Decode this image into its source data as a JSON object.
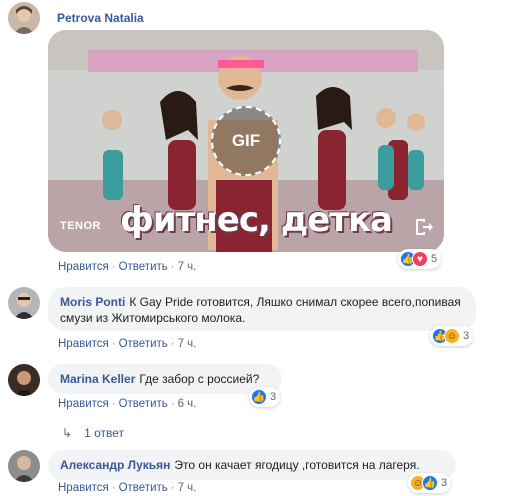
{
  "post": {
    "author": "Petrova Natalia",
    "gif": {
      "badge": "GIF",
      "provider": "TENOR",
      "caption": "фитнес, детка"
    },
    "actions": {
      "like": "Нравится",
      "reply": "Ответить",
      "time": "7 ч."
    },
    "reactions": {
      "count": "5",
      "types": [
        "like-icon",
        "love-icon"
      ]
    }
  },
  "comments": [
    {
      "author": "Moris Ponti",
      "text": "К Gay Pride готовится, Ляшко снимал скорее всего,попивая смузи из Житомирського молока.",
      "actions": {
        "like": "Нравится",
        "reply": "Ответить",
        "time": "7 ч."
      },
      "reactions": {
        "count": "3",
        "types": [
          "like-icon",
          "haha-icon"
        ]
      }
    },
    {
      "author": "Marina Keller",
      "text": "Где забор с россией?",
      "actions": {
        "like": "Нравится",
        "reply": "Ответить",
        "time": "6 ч."
      },
      "reactions": {
        "count": "3",
        "types": [
          "like-icon"
        ]
      },
      "replies": "1 ответ"
    },
    {
      "author": "Александр Лукьян",
      "text": "Это он качает ягодицу ,готовится на лагеря.",
      "actions": {
        "like": "Нравится",
        "reply": "Ответить",
        "time": "7 ч."
      },
      "reactions": {
        "count": "3",
        "types": [
          "haha-icon",
          "like-icon"
        ]
      }
    }
  ],
  "colors": {
    "link": "#385898",
    "bubble": "#f2f3f5",
    "like": "#1877f2",
    "love": "#f33e58",
    "haha": "#f7b125"
  }
}
